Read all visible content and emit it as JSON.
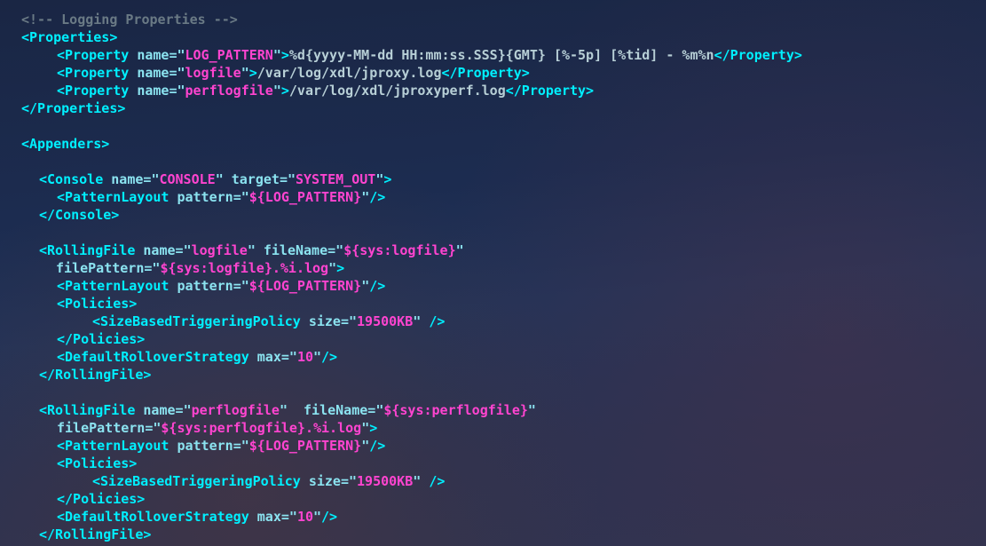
{
  "comment": "<!-- Logging Properties -->",
  "tags": {
    "Properties_open": "<Properties>",
    "Properties_close": "</Properties>",
    "Property_open": "<Property",
    "Property_close": "</Property>",
    "Appenders_open": "<Appenders>",
    "Console_open": "<Console",
    "Console_close": "</Console>",
    "PatternLayout_open": "<PatternLayout",
    "RollingFile_open": "<RollingFile",
    "RollingFile_close": "</RollingFile>",
    "Policies_open": "<Policies>",
    "Policies_close": "</Policies>",
    "Size_open": "<SizeBasedTriggeringPolicy",
    "DRS_open": "<DefaultRolloverStrategy",
    "gt": ">",
    "slashgt": "/>"
  },
  "attrs": {
    "name": "name",
    "target": "target",
    "pattern": "pattern",
    "fileName": "fileName",
    "filePattern": "filePattern",
    "size": "size",
    "max": "max"
  },
  "vals": {
    "LOG_PATTERN": "LOG_PATTERN",
    "logfile": "logfile",
    "perflogfile": "perflogfile",
    "CONSOLE": "CONSOLE",
    "SYSTEM_OUT": "SYSTEM_OUT",
    "patternRef": "${LOG_PATTERN}",
    "sysLogfile": "${sys:logfile}",
    "sysLogfilePattern": "${sys:logfile}.%i.log",
    "sysPerflogfile": "${sys:perflogfile}",
    "sysPerflogfilePattern": "${sys:perflogfile}.%i.log",
    "size19500": "19500KB",
    "max10": "10"
  },
  "text": {
    "logPatternValue": "%d{yyyy-MM-dd HH:mm:ss.SSS}{GMT} [%-5p] [%tid] - %m%n",
    "logfilePath": "/var/log/xdl/jproxy.log",
    "perflogfilePath": "/var/log/xdl/jproxyperf.log"
  }
}
